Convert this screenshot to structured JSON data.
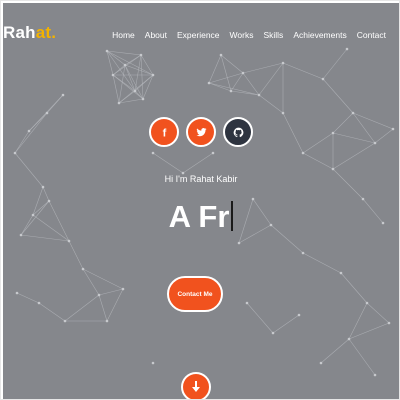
{
  "brand": {
    "name": "Rah",
    "accent": "at",
    "dot": ".",
    "accent_color": "#f3b200"
  },
  "nav": {
    "items": [
      {
        "label": "Home"
      },
      {
        "label": "About"
      },
      {
        "label": "Experience"
      },
      {
        "label": "Works"
      },
      {
        "label": "Skills"
      },
      {
        "label": "Achievements"
      },
      {
        "label": "Contact"
      }
    ]
  },
  "socials": [
    {
      "icon": "facebook-icon",
      "glyph": "f",
      "color": "#f1521e"
    },
    {
      "icon": "twitter-icon",
      "color": "#f1521e"
    },
    {
      "icon": "github-icon",
      "color": "#2e3440"
    }
  ],
  "hero": {
    "greeting": "Hi I'm Rahat Kabir",
    "typed_text": "A Fr",
    "cta_label": "Contact Me",
    "cta_color": "#f1521e",
    "background_color": "#85878c"
  },
  "scroll_down": {
    "icon": "arrow-down-icon",
    "color": "#f1521e"
  }
}
